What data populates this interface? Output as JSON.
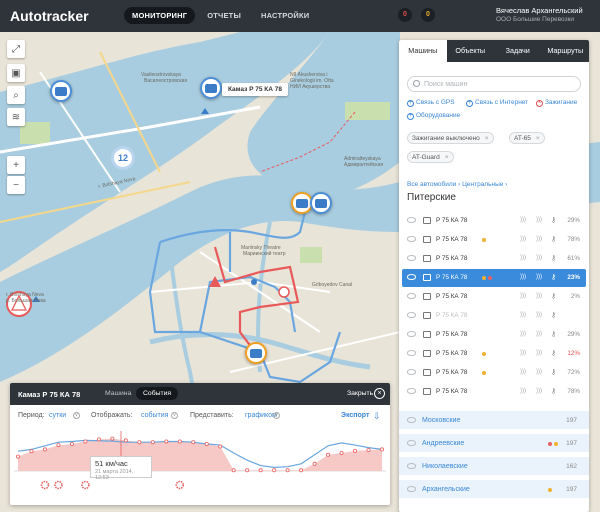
{
  "app": {
    "logo": "Autotracker"
  },
  "nav": [
    {
      "label": "МОНИТОРИНГ",
      "active": true
    },
    {
      "label": "ОТЧЕТЫ",
      "active": false
    },
    {
      "label": "НАСТРОЙКИ",
      "active": false
    }
  ],
  "counters": {
    "alerts": "0",
    "warnings": "0",
    "alerts_color": "#e0504a",
    "warnings_color": "#f0b030"
  },
  "user": {
    "name": "Вячеслав Архангельский",
    "org": "ООО Большие Перевозки"
  },
  "map": {
    "selected_vehicle_tag": "Камаз Р 75 КА 78",
    "cluster_count": "12",
    "labels": {
      "vasileostrovskaya": "Vasileostrovskaya",
      "vasileostrovskaya_ru": "Василеостровская",
      "akusherstva": "NII Akusherstva i",
      "gineko": "Ginekologii im. Otta",
      "nii_ru": "НИИ Акушерства",
      "bolshaya_neva": "r. Bolshaya Neva",
      "mariinsky": "Mariinsky Theatre",
      "mariinsky_ru": "Мариинский театр",
      "admiralteyskaya": "Admiralteyskaya",
      "admiralteyskaya_ru": "Адмиралтейская",
      "griboyedov": "Griboyedov Canal",
      "bolshaya_neva_left": "r. Bolshaya Neva",
      "bolshaya_neva_left_ru": "р. Большая Нева"
    },
    "accent_route": "#e85a5a",
    "accent_track": "#5a9ee0"
  },
  "panel": {
    "title": "Камаз Р 75 КА 78",
    "tabs": [
      {
        "label": "Машина",
        "active": false
      },
      {
        "label": "События",
        "active": true
      }
    ],
    "close_label": "Закрыть",
    "period_label": "Период:",
    "period_value": "сутки",
    "display_label": "Отображать:",
    "display_value": "события",
    "present_label": "Представить:",
    "present_value": "графиком",
    "export_label": "Экспорт",
    "tooltip_value": "51 км/час",
    "tooltip_date": "21 марта 2014, 12:53"
  },
  "chart_data": {
    "type": "line",
    "series": [
      {
        "values": [
          0.55,
          0.6,
          0.7,
          0.8,
          0.82,
          0.85,
          0.84,
          0.83,
          0.8,
          0.8,
          0.8,
          0.82,
          0.82,
          0.8,
          0.75,
          0.72,
          0.5,
          0.3,
          0.15,
          0.1,
          0.12,
          0.2,
          0.45,
          0.7,
          0.78,
          0.72,
          0.65,
          0.6
        ]
      },
      {
        "values": [
          0.4,
          0.55,
          0.6,
          0.72,
          0.75,
          0.82,
          0.88,
          0.9,
          0.85,
          0.8,
          0.8,
          0.82,
          0.82,
          0.8,
          0.75,
          0.68,
          0.02,
          0.02,
          0.02,
          0.02,
          0.02,
          0.02,
          0.2,
          0.45,
          0.5,
          0.56,
          0.58,
          0.6
        ]
      }
    ],
    "event_markers": [
      2,
      3,
      5,
      12
    ],
    "colors": {
      "line": "#6aa6e0",
      "area": "#f7c9c6",
      "point": "#e86060"
    }
  },
  "sidebar": {
    "tabs": [
      {
        "label": "Машины",
        "active": true
      },
      {
        "label": "Объекты",
        "active": false
      },
      {
        "label": "Задачи",
        "active": false
      },
      {
        "label": "Маршруты",
        "active": false
      }
    ],
    "search_placeholder": "Поиск машин",
    "quick_filters": {
      "gps": "Связь с GPS",
      "internet": "Связь с Интернет",
      "ignition": "Зажигание",
      "equipment": "Оборудование"
    },
    "chips": {
      "ignition_off": "Зажигание выключено",
      "at65": "AT-65",
      "at_guard": "AT-Guard"
    },
    "breadcrumb": "Все автомобили  ›  Центральные  ›",
    "group_title": "Питерские",
    "vehicles": [
      {
        "name": "Р 75 КА 78",
        "pct": "29%",
        "dot": ""
      },
      {
        "name": "Р 75 КА 78",
        "pct": "78%",
        "dot": "#f0b030"
      },
      {
        "name": "Р 75 КА 78",
        "pct": "61%",
        "dot": ""
      },
      {
        "name": "Р 75 КА 78",
        "pct": "23%",
        "dot": "#f0b030",
        "dot2": "#e86060",
        "selected": true
      },
      {
        "name": "Р 75 КА 78",
        "pct": "2%",
        "dot": ""
      },
      {
        "name": "Р 75 КА 78",
        "pct": "",
        "dot": "",
        "muted": true
      },
      {
        "name": "Р 75 КА 78",
        "pct": "29%",
        "dot": ""
      },
      {
        "name": "Р 75 КА 78",
        "pct": "12%",
        "dot": "#f0b030",
        "pct_red": true
      },
      {
        "name": "Р 75 КА 78",
        "pct": "72%",
        "dot": "#f0b030"
      },
      {
        "name": "Р 75 КА 78",
        "pct": "78%",
        "dot": ""
      }
    ],
    "groups": [
      {
        "name": "Московские",
        "count": "197",
        "dots": []
      },
      {
        "name": "Андреевские",
        "count": "197",
        "dots": [
          "#e86060",
          "#f0b030"
        ]
      },
      {
        "name": "Николаевские",
        "count": "162",
        "dots": []
      },
      {
        "name": "Архангельские",
        "count": "197",
        "dots": [
          "#f0b030"
        ]
      }
    ]
  }
}
